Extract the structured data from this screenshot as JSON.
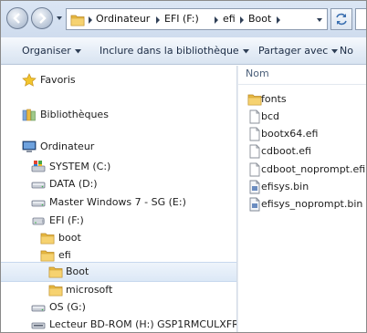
{
  "address_bar": {
    "crumbs": [
      "Ordinateur",
      "EFI (F:)",
      "efi",
      "Boot"
    ]
  },
  "toolbar": {
    "organize": "Organiser",
    "include": "Inclure dans la bibliothèque",
    "share": "Partager avec",
    "new_truncated": "No"
  },
  "nav": {
    "favorites": "Favoris",
    "libraries": "Bibliothèques",
    "computer": "Ordinateur",
    "drives": [
      {
        "label": "SYSTEM (C:)",
        "icon": "system-drive-icon"
      },
      {
        "label": "DATA (D:)",
        "icon": "drive-icon"
      },
      {
        "label": "Master Windows 7 - SG (E:)",
        "icon": "drive-icon"
      },
      {
        "label": "EFI (F:)",
        "icon": "usb-drive-icon"
      }
    ],
    "efi_children": {
      "boot_lower": "boot",
      "efi": "efi",
      "boot_selected": "Boot",
      "microsoft": "microsoft"
    },
    "os_drive": "OS (G:)",
    "bd_drive": "Lecteur BD-ROM (H:) GSP1RMCULXFRER_"
  },
  "file_list": {
    "column_name": "Nom",
    "items": [
      {
        "name": "fonts",
        "icon": "folder-icon"
      },
      {
        "name": "bcd",
        "icon": "file-icon"
      },
      {
        "name": "bootx64.efi",
        "icon": "file-icon"
      },
      {
        "name": "cdboot.efi",
        "icon": "file-icon"
      },
      {
        "name": "cdboot_noprompt.efi",
        "icon": "file-icon"
      },
      {
        "name": "efisys.bin",
        "icon": "bin-file-icon"
      },
      {
        "name": "efisys_noprompt.bin",
        "icon": "bin-file-icon"
      }
    ]
  },
  "colors": {
    "folder": "#e9b93f",
    "selection": "#dce8f6",
    "toolbar_text": "#1b2b44"
  }
}
